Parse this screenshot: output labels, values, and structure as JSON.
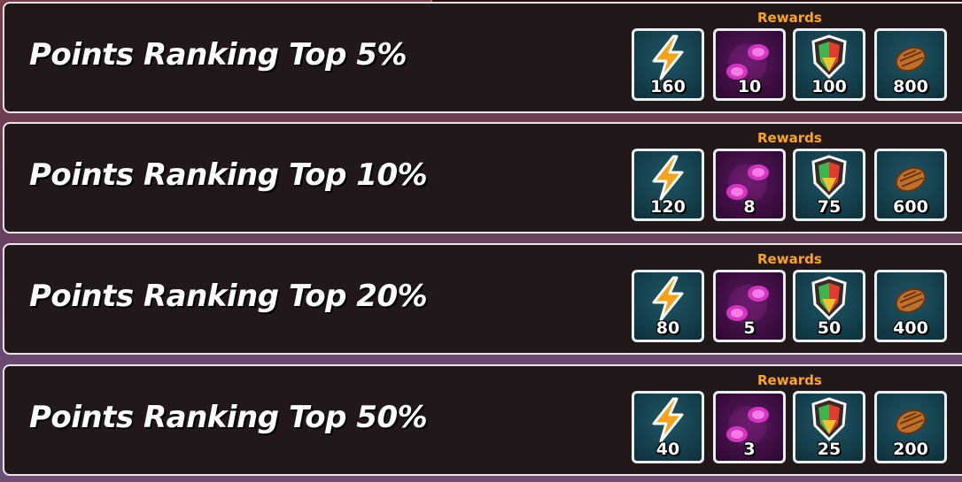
{
  "rewards_heading": "Rewards",
  "reward_icons": [
    "lightning-icon",
    "magic-stones-icon",
    "rainbow-gem-shield-icon",
    "pinecone-icon"
  ],
  "rows": [
    {
      "title": "Points Ranking Top 5%",
      "rewards": [
        "160",
        "10",
        "100",
        "800"
      ]
    },
    {
      "title": "Points Ranking Top 10%",
      "rewards": [
        "120",
        "8",
        "75",
        "600"
      ]
    },
    {
      "title": "Points Ranking Top 20%",
      "rewards": [
        "80",
        "5",
        "50",
        "400"
      ]
    },
    {
      "title": "Points Ranking Top 50%",
      "rewards": [
        "40",
        "3",
        "25",
        "200"
      ]
    }
  ],
  "colors": {
    "row_bg": "#221819",
    "rewards_text": "#f5a623",
    "tile_teal": "#123c48",
    "tile_purple": "#3a0c3e"
  }
}
